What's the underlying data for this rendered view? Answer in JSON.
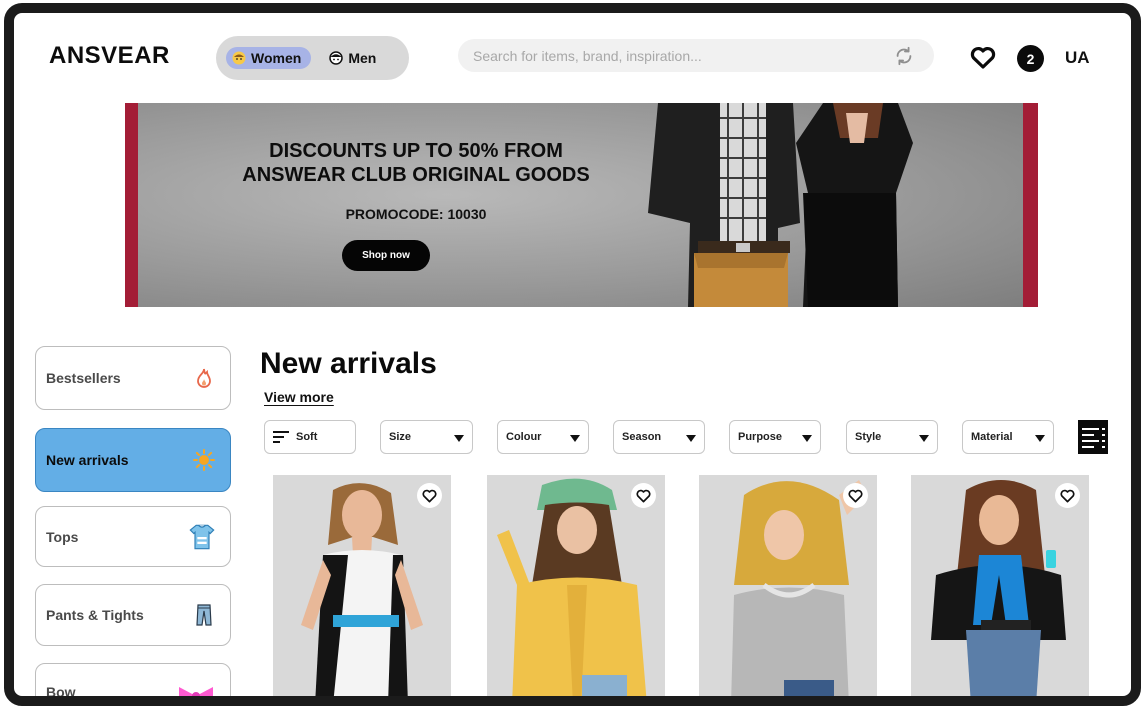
{
  "header": {
    "logo": "ANSVEAR",
    "gender": [
      {
        "label": "Women",
        "active": true
      },
      {
        "label": "Men",
        "active": false
      }
    ],
    "search_placeholder": "Search for items, brand, inspiration...",
    "cart_count": "2",
    "language": "UA"
  },
  "banner": {
    "title_line1": "DISCOUNTS UP TO 50% FROM",
    "title_line2": "ANSWEAR CLUB ORIGINAL GOODS",
    "promo": "PROMOCODE: 10030",
    "cta": "Shop now"
  },
  "sidebar": {
    "categories": [
      {
        "label": "Bestsellers",
        "icon": "fire-icon",
        "active": false
      },
      {
        "label": "New arrivals",
        "icon": "sun-icon",
        "active": true
      },
      {
        "label": "Tops",
        "icon": "shirt-icon",
        "active": false
      },
      {
        "label": "Pants & Tights",
        "icon": "pants-icon",
        "active": false
      },
      {
        "label": "Bow",
        "icon": "bow-icon",
        "active": false
      }
    ]
  },
  "main": {
    "title": "New arrivals",
    "view_more": "View more",
    "filters": [
      "Soft",
      "Size",
      "Colour",
      "Season",
      "Purpose",
      "Style",
      "Material"
    ]
  },
  "products": [
    {
      "image": "model-white-black-dress"
    },
    {
      "image": "model-yellow-cardigan-green-hat"
    },
    {
      "image": "model-grey-sweater-curly-hair"
    },
    {
      "image": "model-black-jacket-blue-scarf"
    }
  ],
  "colors": {
    "accent_active": "#63aee6",
    "gender_active": "#a7b3e6",
    "banner_border": "#a31d36"
  }
}
